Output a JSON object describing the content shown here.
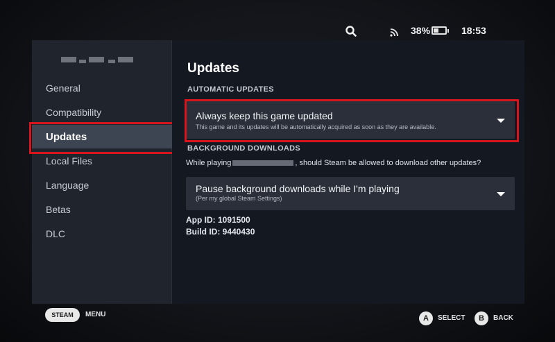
{
  "status": {
    "battery_percent": "38%",
    "battery_level": 0.38,
    "time": "18:53",
    "icons": [
      "search-icon",
      "wifi-icon",
      "battery-icon"
    ]
  },
  "sidebar": {
    "items": [
      {
        "label": "General"
      },
      {
        "label": "Compatibility"
      },
      {
        "label": "Updates"
      },
      {
        "label": "Local Files"
      },
      {
        "label": "Language"
      },
      {
        "label": "Betas"
      },
      {
        "label": "DLC"
      }
    ],
    "active": "Updates"
  },
  "main": {
    "title": "Updates",
    "automatic_updates": {
      "section_label": "AUTOMATIC UPDATES",
      "dropdown_label": "Always keep this game updated",
      "dropdown_sub": "This game and its updates will be automatically acquired as soon as they are available."
    },
    "background_downloads": {
      "section_label": "BACKGROUND DOWNLOADS",
      "question_prefix": "While playing",
      "question_suffix": ", should Steam be allowed to download other updates?",
      "dropdown_label": "Pause background downloads while I'm playing",
      "dropdown_sub": "(Per my global Steam Settings)"
    },
    "app_id": "App ID: 1091500",
    "build_id": "Build ID: 9440430"
  },
  "footer": {
    "steam_label": "STEAM",
    "menu_label": "MENU",
    "a_glyph": "A",
    "select_label": "SELECT",
    "b_glyph": "B",
    "back_label": "BACK"
  },
  "colors": {
    "highlight": "#d6161c",
    "sidebar_bg": "#20242c",
    "active_item_bg": "#3d4452",
    "dropdown_bg": "#2a2f39"
  }
}
